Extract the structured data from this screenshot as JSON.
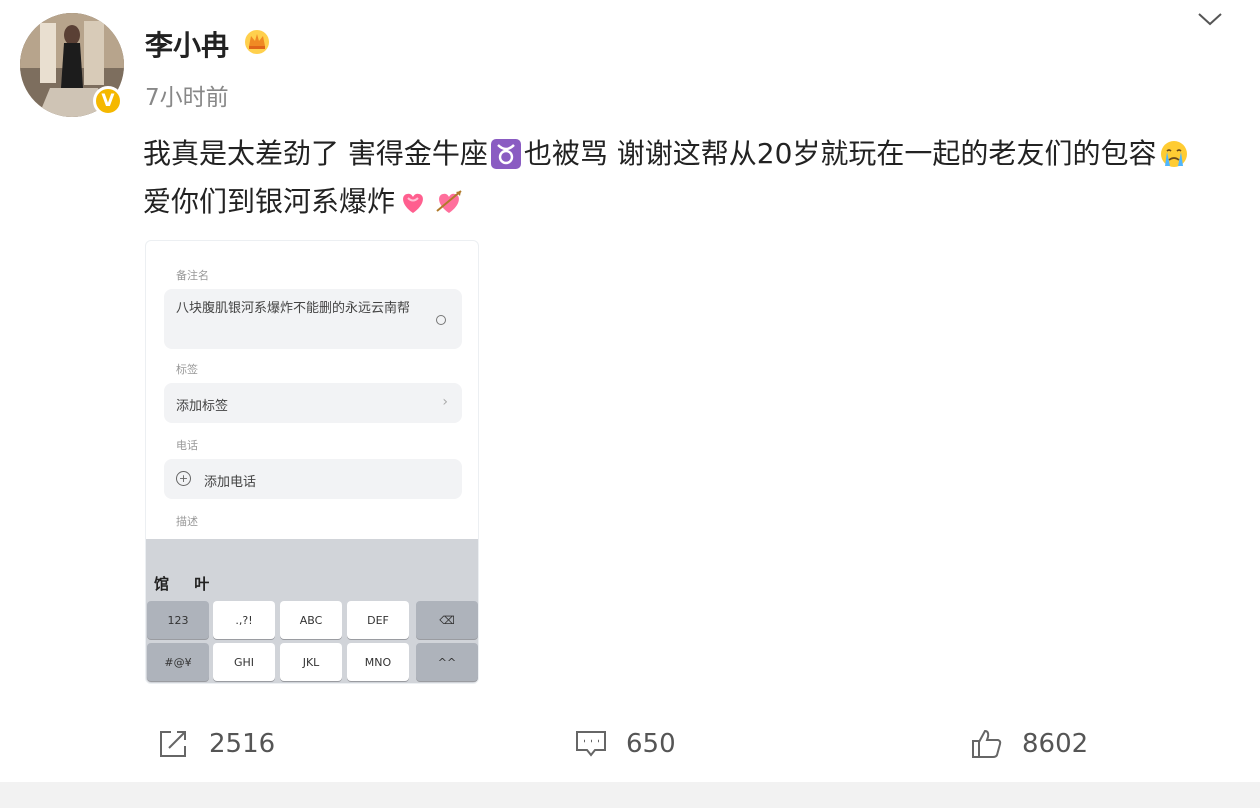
{
  "post": {
    "author": "李小冉",
    "time": "7小时前",
    "text_line1": "我真是太差劲了 害得金牛座",
    "text_line1b": "也被骂 谢谢这帮从20岁就玩在一起的老友们的包",
    "text_line2a": "容",
    "text_line2b": " 爱你们到银河系爆炸",
    "icons": {
      "verified": "verified-badge-icon",
      "crown": "crown-icon",
      "menu": "chevron-down-icon",
      "taurus": "taurus-emoji",
      "crying": "crying-face-emoji",
      "hearts": "heart-with-ribbon-emoji"
    }
  },
  "attached_image": {
    "note_label": "备注名",
    "note_value": "八块腹肌银河系爆炸不能删的永远云南帮",
    "tag_label": "标签",
    "tag_value": "添加标签",
    "phone_label": "电话",
    "phone_value": "添加电话",
    "desc_label": "描述",
    "candidates": "馆 叶",
    "keys_row1": [
      "123",
      ".,?!",
      "ABC",
      "DEF"
    ],
    "keys_row2": [
      "#@¥",
      "GHI",
      "JKL",
      "MNO",
      "^^"
    ]
  },
  "actions": {
    "repost_count": "2516",
    "comment_count": "650",
    "like_count": "8602"
  },
  "colors": {
    "badge": "#f5b800",
    "text": "#222222",
    "muted": "#888888"
  }
}
